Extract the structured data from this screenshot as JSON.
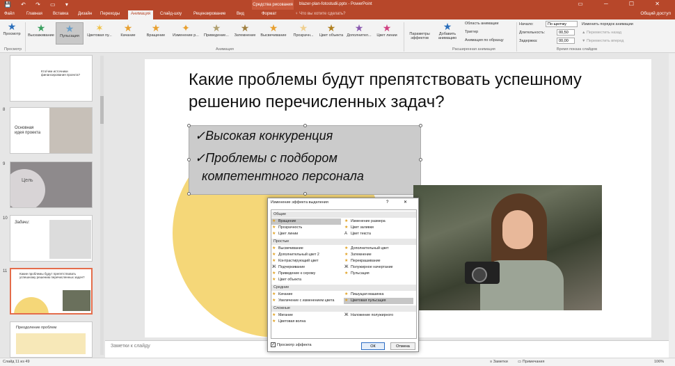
{
  "titlebar": {
    "qat": "💾 ↶ ↷ ▭ ▾",
    "context_tab": "Средства рисования",
    "title": "blazer-plan-fotostudii.pptx - PowerPoint",
    "win_buttons": "▭ ─ ☐ ✕"
  },
  "tabs": {
    "items": [
      "Файл",
      "Главная",
      "Вставка",
      "Дизайн",
      "Переходы",
      "Анимация",
      "Слайд-шоу",
      "Рецензирование",
      "Вид",
      "Формат"
    ],
    "search": "♀ Что вы хотите сделать?",
    "share": "Общий доступ"
  },
  "ribbon": {
    "preview": "Просмотр",
    "preview_group": "Просмотр",
    "effects": [
      "Выскаживание",
      "Пульсация",
      "Цветовая пу...",
      "Качание",
      "Вращение",
      "Изменение р...",
      "Приведение...",
      "Затемнение",
      "Высвечивание",
      "Прозрачн...",
      "Цвет объекта",
      "Дополнител...",
      "Цвет линии"
    ],
    "animation_group": "Анимация",
    "effect_params": "Параметры эффектов",
    "add_animation": "Добавить анимацию",
    "anim_area": "Область анимации",
    "trigger": "Триггер",
    "anim_by_sample": "Анимация по образцу",
    "ext_anim_group": "Расширенная анимация",
    "start_label": "Начало:",
    "start_value": "По щелчку",
    "duration_label": "Длительность:",
    "duration_value": "00,50",
    "delay_label": "Задержка:",
    "delay_value": "00,00",
    "reorder_label": "Изменить порядок анимации",
    "move_earlier": "▲ Переместить назад",
    "move_later": "▼ Переместить вперед",
    "timing_group": "Время показа слайдов"
  },
  "thumbnails": [
    {
      "num": "",
      "text": "Кто/чем источники финансирования проекта?"
    },
    {
      "num": "8",
      "text": "Основная идея проекта"
    },
    {
      "num": "9",
      "text": "Цель"
    },
    {
      "num": "10",
      "text": "Задачи:"
    },
    {
      "num": "11",
      "text": "Какие проблемы будут препятствовать успешному решению перечисленных задач?"
    },
    {
      "num": "",
      "text": "Преодоление проблем"
    }
  ],
  "slide": {
    "title": "Какие проблемы будут препятствовать успешному решению перечисленных задач?",
    "bullet1": "✓Высокая конкуренция",
    "bullet2a": "✓Проблемы с подбором",
    "bullet2b": "компетентного персонала"
  },
  "notes": "Заметки к слайду",
  "status": {
    "slide": "Слайд 11 из 49",
    "lang": "",
    "notes_btn": "≡ Заметки",
    "comments_btn": "▭ Примечания",
    "zoom": "106%"
  },
  "dialog": {
    "title": "Изменение эффекта выделения",
    "buttons": "? ✕",
    "categories": [
      "Общие",
      "Простые",
      "Средние",
      "Сложные"
    ],
    "general": [
      "Вращение",
      "Изменение размера",
      "Прозрачность",
      "Цвет заливки",
      "Цвет линии",
      "Цвет текста"
    ],
    "simple": [
      "Высвечивание",
      "Дополнительный цвет",
      "Дополнительный цвет 2",
      "Затемнение",
      "Контрастирующий цвет",
      "Перекрашивание",
      "Подчеркивание",
      "Полужирное начертание",
      "Приведение к серому",
      "Пульсация",
      "Цвет объекта"
    ],
    "medium": [
      "Качание",
      "Пишущая машинка",
      "Увеличение с изменением цвета",
      "Цветовая пульсация"
    ],
    "complex": [
      "Мигание",
      "Наложение полужирного",
      "Цветовая волна"
    ],
    "preview_label": "Просмотр эффекта",
    "ok": "ОК",
    "cancel": "Отмена"
  },
  "colors": {
    "accent": "#b7472a",
    "blob": "#f5d778",
    "selected": "#c6c6c6"
  }
}
